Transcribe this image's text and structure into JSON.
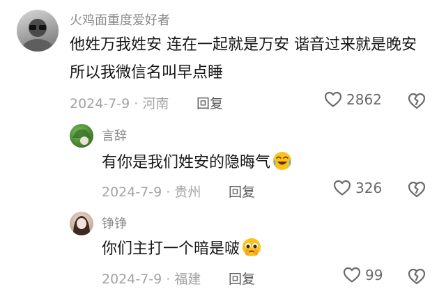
{
  "comments": [
    {
      "username": "火鸡面重度爱好者",
      "body": "他姓万我姓安 连在一起就是万安 谐音过来就是晚安 所以我微信名叫早点睡",
      "meta": "2024-7-9 · 河南",
      "reply_label": "回复",
      "likes": "2862",
      "avatar": "avatar-icon"
    },
    {
      "username": "言辞",
      "body": "有你是我们姓安的隐晦气",
      "body_emoji": "crying-laughing-emoji-icon",
      "meta": "2024-7-9 · 贵州",
      "reply_label": "回复",
      "likes": "326",
      "avatar": "avatar-icon"
    },
    {
      "username": "铮铮",
      "body": "你们主打一个暗是啵",
      "body_emoji": "pleading-teary-emoji-icon",
      "meta": "2024-7-9 · 福建",
      "reply_label": "回复",
      "likes": "99",
      "avatar": "avatar-icon"
    }
  ],
  "icons": {
    "like": "heart-outline-icon",
    "dislike": "broken-heart-icon"
  },
  "colors": {
    "text": "#161616",
    "username": "#8a8a8a",
    "meta": "#a3a3a3",
    "icon": "#6a6a6a"
  }
}
